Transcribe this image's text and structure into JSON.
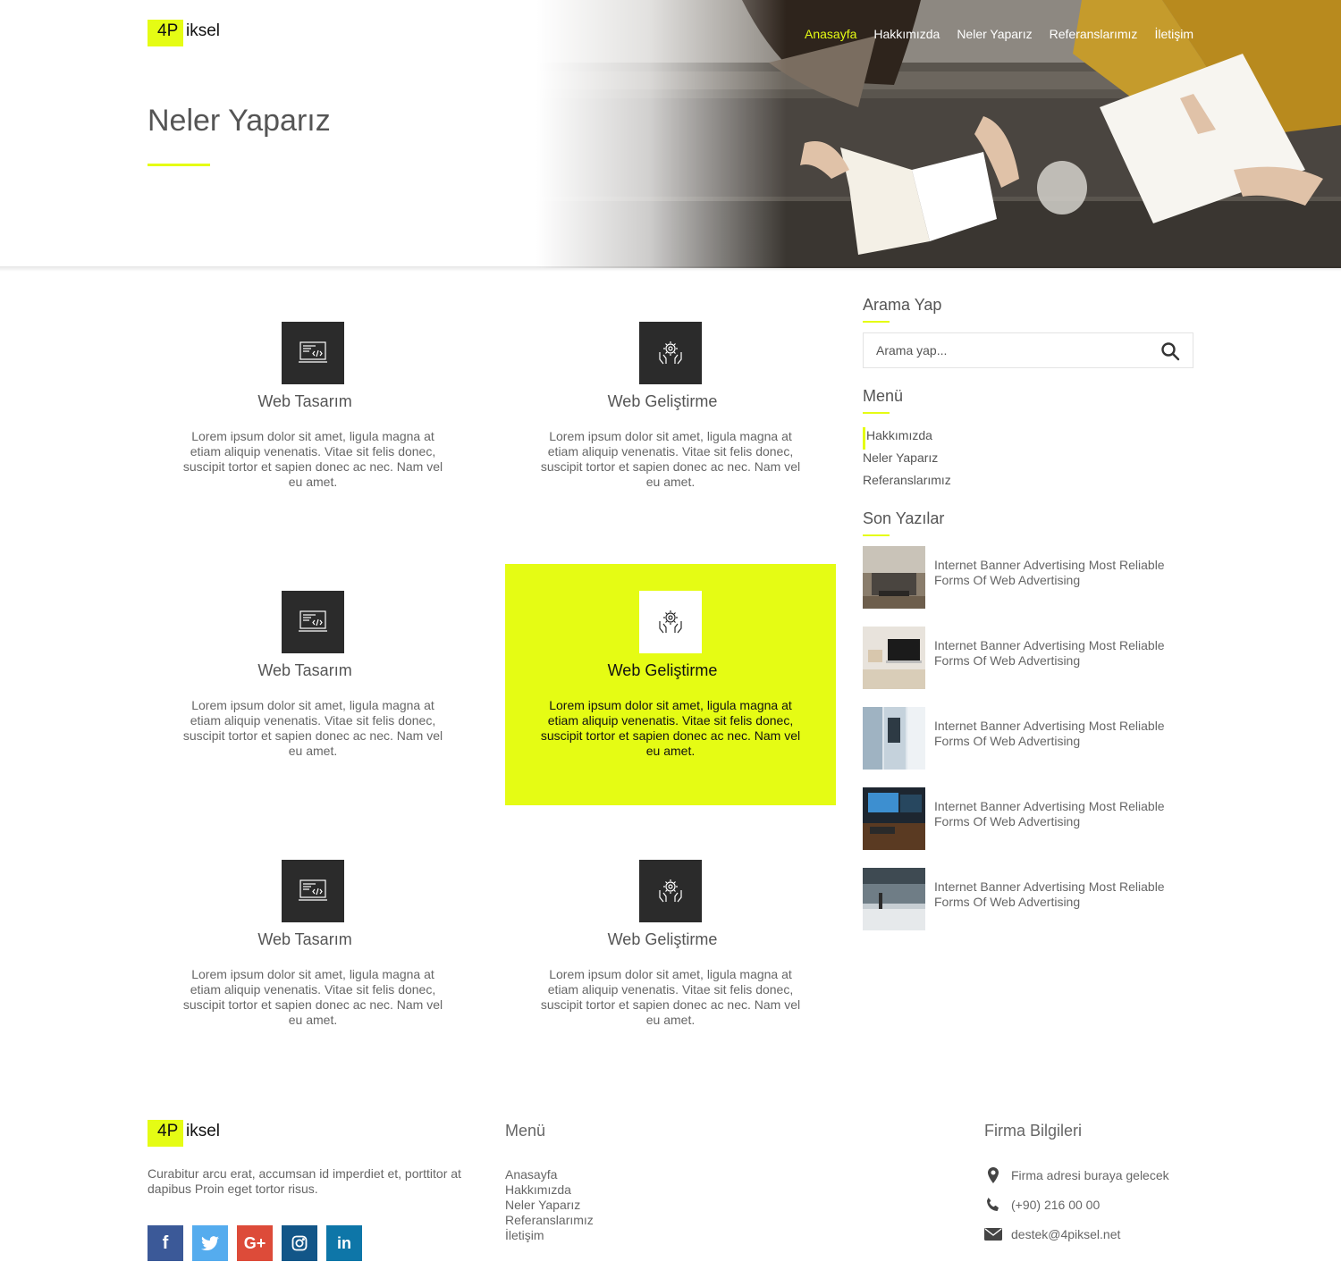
{
  "brand": {
    "logo_mark": "4P",
    "logo_text": "iksel",
    "accent": "#e5fc14"
  },
  "nav": {
    "items": [
      {
        "label": "Anasayfa",
        "active": true
      },
      {
        "label": "Hakkımızda"
      },
      {
        "label": "Neler Yaparız"
      },
      {
        "label": "Referanslarımız"
      },
      {
        "label": "İletişim"
      }
    ]
  },
  "hero": {
    "title": "Neler Yaparız"
  },
  "services": [
    {
      "icon": "code-laptop-icon",
      "title": "Web Tasarım",
      "desc": "Lorem ipsum dolor sit amet, ligula magna at etiam aliquip venenatis. Vitae sit felis donec, suscipit tortor et sapien donec ac nec. Nam vel eu amet."
    },
    {
      "icon": "gear-hands-icon",
      "title": "Web Geliştirme",
      "desc": "Lorem ipsum dolor sit amet, ligula magna at etiam aliquip venenatis. Vitae sit felis donec, suscipit tortor et sapien donec ac nec. Nam vel eu amet."
    },
    {
      "icon": "code-laptop-icon",
      "title": "Web Tasarım",
      "desc": "Lorem ipsum dolor sit amet, ligula magna at etiam aliquip venenatis. Vitae sit felis donec, suscipit tortor et sapien donec ac nec. Nam vel eu amet."
    },
    {
      "icon": "gear-hands-icon",
      "title": "Web Geliştirme",
      "desc": "Lorem ipsum dolor sit amet, ligula magna at etiam aliquip venenatis. Vitae sit felis donec, suscipit tortor et sapien donec ac nec. Nam vel eu amet.",
      "highlighted": true
    },
    {
      "icon": "code-laptop-icon",
      "title": "Web Tasarım",
      "desc": "Lorem ipsum dolor sit amet, ligula magna at etiam aliquip venenatis. Vitae sit felis donec, suscipit tortor et sapien donec ac nec. Nam vel eu amet."
    },
    {
      "icon": "gear-hands-icon",
      "title": "Web Geliştirme",
      "desc": "Lorem ipsum dolor sit amet, ligula magna at etiam aliquip venenatis. Vitae sit felis donec, suscipit tortor et sapien donec ac nec. Nam vel eu amet."
    }
  ],
  "sidebar": {
    "search": {
      "heading": "Arama Yap",
      "placeholder": "Arama yap...",
      "icon": "search-icon"
    },
    "menu": {
      "heading": "Menü",
      "items": [
        "Hakkımızda",
        "Neler Yaparız",
        "Referanslarımız"
      ]
    },
    "recent": {
      "heading": "Son Yazılar",
      "posts": [
        {
          "title": "Internet Banner Advertising Most Reliable Forms Of Web Advertising"
        },
        {
          "title": "Internet Banner Advertising Most Reliable Forms Of Web Advertising"
        },
        {
          "title": "Internet Banner Advertising Most Reliable Forms Of Web Advertising"
        },
        {
          "title": "Internet Banner Advertising Most Reliable Forms Of Web Advertising"
        },
        {
          "title": "Internet Banner Advertising Most Reliable Forms Of Web Advertising"
        }
      ]
    }
  },
  "footer": {
    "about": "Curabitur arcu erat, accumsan id imperdiet et, porttitor at dapibus Proin eget tortor risus.",
    "social": [
      {
        "name": "facebook-icon",
        "glyph": "f",
        "color": "#3b5998"
      },
      {
        "name": "twitter-icon",
        "glyph": "t",
        "color": "#55acee"
      },
      {
        "name": "google-plus-icon",
        "glyph": "G+",
        "color": "#dd4b39"
      },
      {
        "name": "instagram-icon",
        "glyph": "ig",
        "color": "#125688"
      },
      {
        "name": "linkedin-icon",
        "glyph": "in",
        "color": "#0e76a8"
      }
    ],
    "menu": {
      "heading": "Menü",
      "items": [
        "Anasayfa",
        "Hakkımızda",
        "Neler Yaparız",
        "Referanslarımız",
        "İletişim"
      ]
    },
    "company": {
      "heading": "Firma Bilgileri",
      "address": "Firma adresi buraya gelecek",
      "phone": "(+90) 216 00 00",
      "email": "destek@4piksel.net"
    }
  }
}
